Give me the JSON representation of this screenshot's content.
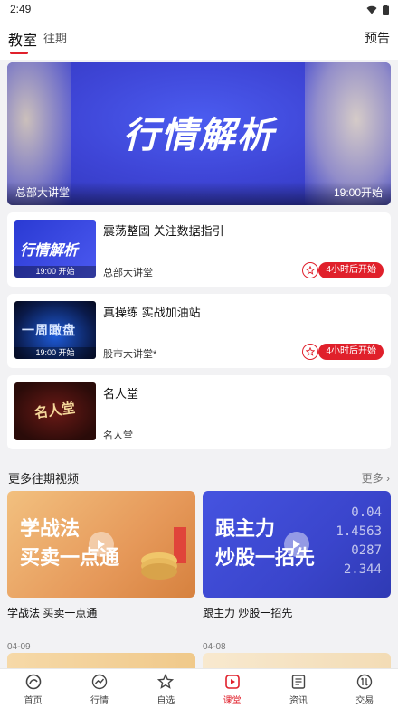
{
  "status": {
    "time": "2:49"
  },
  "tabs": {
    "active": "教室",
    "other": "往期",
    "preview": "预告"
  },
  "hero": {
    "title": "行情解析",
    "left_label": "总部大讲堂",
    "right_label": "19:00开始"
  },
  "courses": [
    {
      "thumb_text": "行情解析",
      "thumb_tag": "19:00 开始",
      "title": "震荡整固 关注数据指引",
      "host": "总部大讲堂",
      "badge": "4小时后开始"
    },
    {
      "thumb_text": "一周瞰盘",
      "thumb_tag": "19:00 开始",
      "title": "真操练 实战加油站",
      "host": "股市大讲堂*",
      "badge": "4小时后开始"
    },
    {
      "thumb_text": "名人堂",
      "title": "名人堂",
      "host": "名人堂"
    }
  ],
  "section": {
    "title": "更多往期视频",
    "more": "更多"
  },
  "videos": [
    {
      "line1": "学战法",
      "line2": "买卖一点通",
      "caption": "学战法 买卖一点通",
      "date": "04-09"
    },
    {
      "line1": "跟主力",
      "line2": "炒股一招先",
      "caption": "跟主力 炒股一招先",
      "date": "04-08",
      "ticker": [
        "0.04",
        "1.4563",
        "0287",
        "2.344"
      ]
    }
  ],
  "tabbar": [
    {
      "label": "首页",
      "icon": "home-icon"
    },
    {
      "label": "行情",
      "icon": "market-icon"
    },
    {
      "label": "自选",
      "icon": "star-icon"
    },
    {
      "label": "课堂",
      "icon": "classroom-icon",
      "active": true
    },
    {
      "label": "资讯",
      "icon": "news-icon"
    },
    {
      "label": "交易",
      "icon": "trade-icon"
    }
  ],
  "colors": {
    "accent": "#e0202b",
    "hero_blue": "#3e45d6"
  }
}
